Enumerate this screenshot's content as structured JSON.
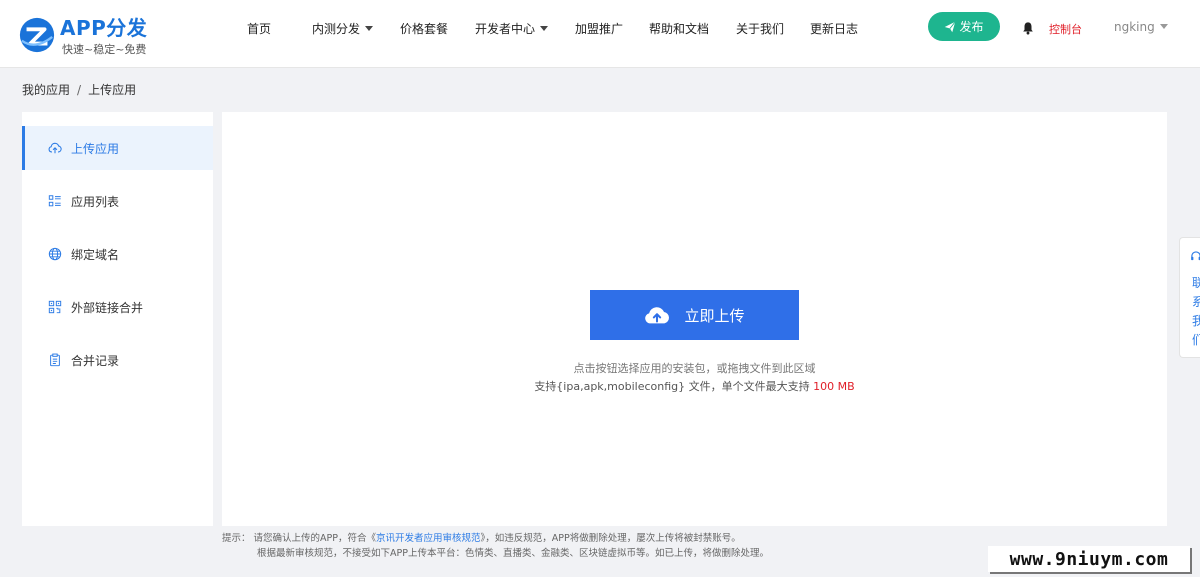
{
  "header": {
    "logo_title": "APP分发",
    "logo_subtitle": "快速~稳定~免费",
    "nav": [
      {
        "label": "首页"
      },
      {
        "label": "内测分发"
      },
      {
        "label": "价格套餐"
      },
      {
        "label": "开发者中心"
      },
      {
        "label": "加盟推广"
      },
      {
        "label": "帮助和文档"
      },
      {
        "label": "关于我们"
      },
      {
        "label": "更新日志"
      }
    ],
    "publish_label": "发布",
    "console_label": "控制台",
    "username": "ngking"
  },
  "breadcrumb": {
    "parent": "我的应用",
    "separator": "/",
    "current": "上传应用"
  },
  "sidebar": {
    "items": [
      {
        "label": "上传应用",
        "icon": "cloud-upload-icon"
      },
      {
        "label": "应用列表",
        "icon": "list-icon"
      },
      {
        "label": "绑定域名",
        "icon": "globe-icon"
      },
      {
        "label": "外部链接合并",
        "icon": "qrcode-icon"
      },
      {
        "label": "合并记录",
        "icon": "clipboard-icon"
      }
    ]
  },
  "upload": {
    "button_label": "立即上传",
    "hint_line1": "点击按钮选择应用的安装包，或拖拽文件到此区域",
    "hint_line2": "支持{ipa,apk,mobileconfig} 文件，单个文件最大支持",
    "size_limit": "100 MB"
  },
  "tips": {
    "prefix": "提示：",
    "line1_a": "请您确认上传的APP，符合《",
    "line1_link": "京讯开发者应用审核规范",
    "line1_b": "》，如违反规范，APP将做删除处理，屡次上传将被封禁账号。",
    "line2": "根据最新审核规范，不接受如下APP上传本平台：色情类、直播类、金融类、区块链虚拟币等。如已上传，将做删除处理。"
  },
  "float_panel": {
    "label": "联系我们"
  },
  "watermark": "www.9niuym.com",
  "colors": {
    "brand_blue": "#2f6fe8",
    "publish_green": "#1eb58f",
    "alert_red": "#e0202a"
  }
}
